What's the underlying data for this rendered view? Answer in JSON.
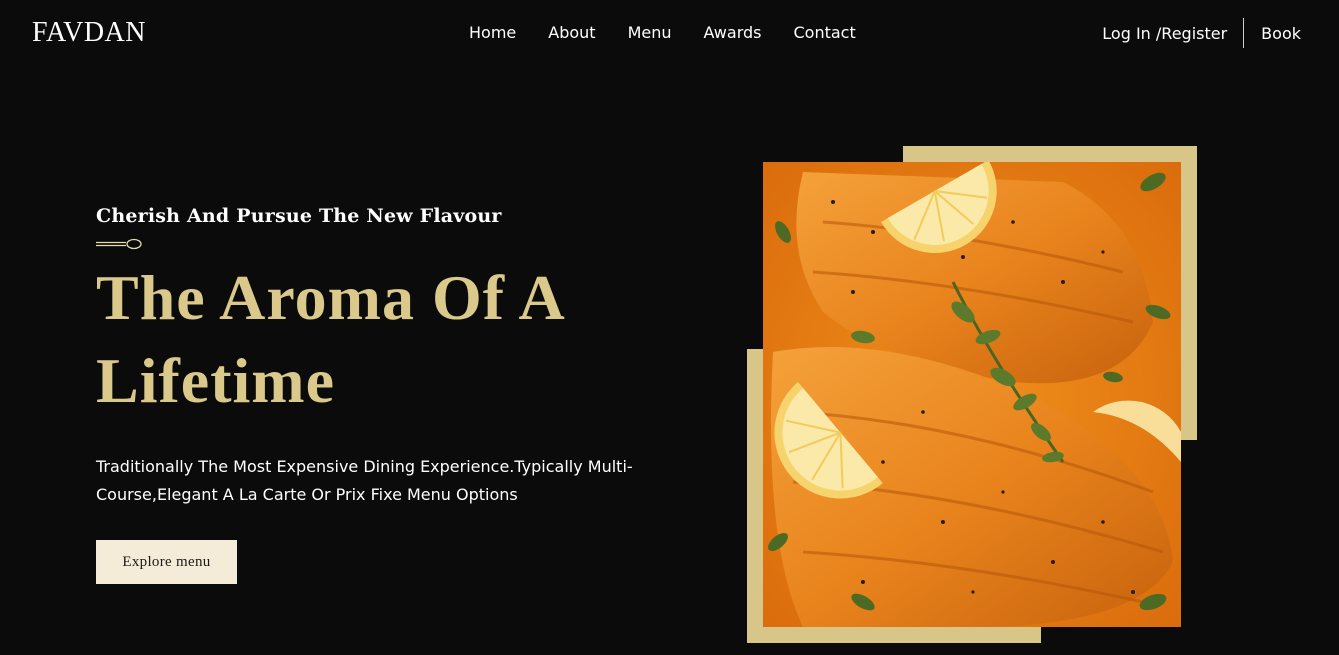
{
  "header": {
    "logo": "FAVDAN",
    "nav": [
      "Home",
      "About",
      "Menu",
      "Awards",
      "Contact"
    ],
    "login_label": "Log In /Register",
    "book_label": "Book"
  },
  "hero": {
    "tagline": "Cherish And Pursue The New Flavour",
    "title_line1": "The Aroma Of A",
    "title_line2": "Lifetime",
    "description": "Traditionally The Most Expensive Dining Experience.Typically Multi-Course,Elegant A La Carte Or Prix Fixe Menu Options",
    "cta_label": "Explore menu"
  },
  "colors": {
    "background": "#0b0b0c",
    "accent_gold": "#dac98a",
    "frame_gold": "#d8c689",
    "button_bg": "#f4ecd8"
  },
  "icons": {
    "divider": "spoon-icon"
  }
}
